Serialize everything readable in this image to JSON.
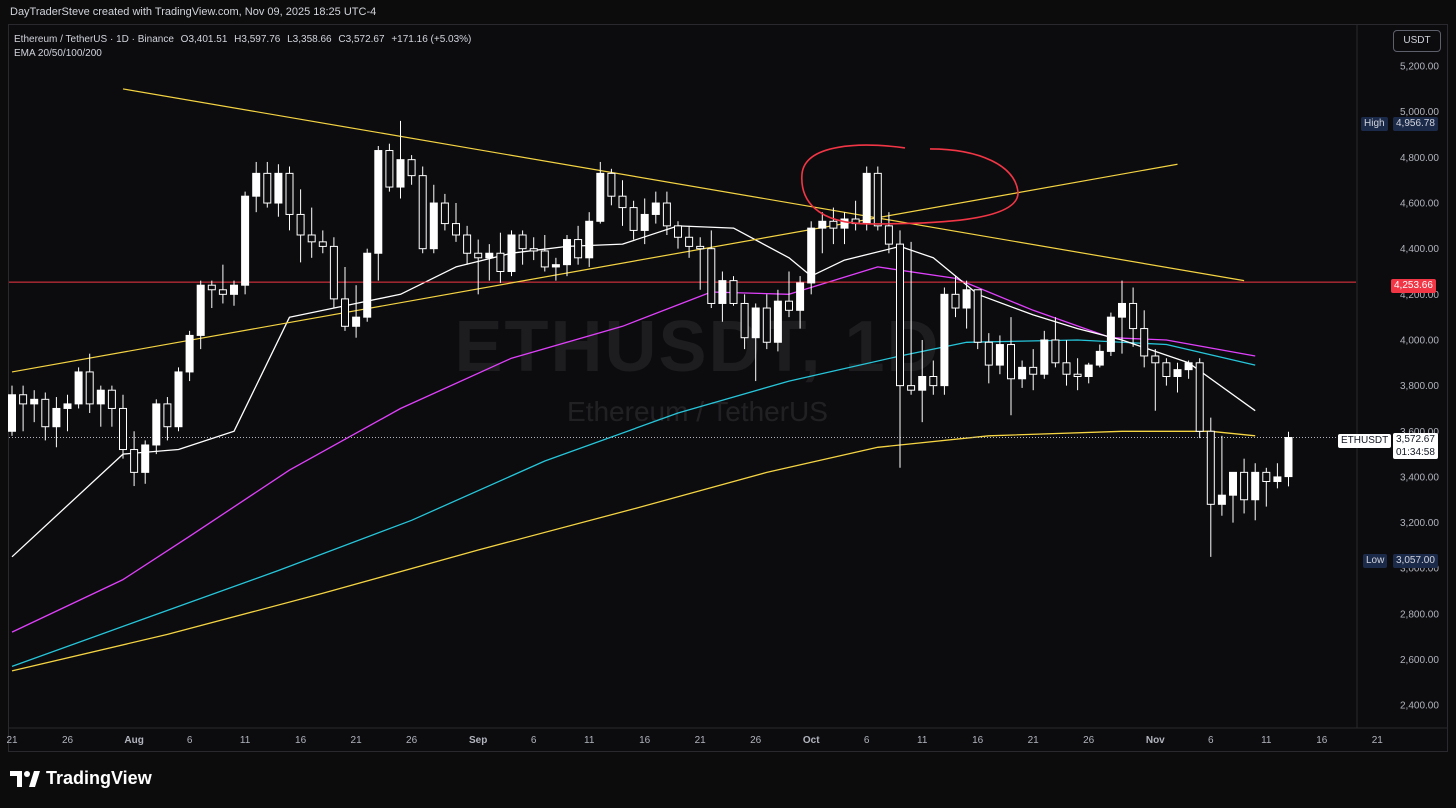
{
  "topbar": {
    "attribution": "DayTraderSteve created with TradingView.com, Nov 09, 2025 18:25 UTC-4"
  },
  "legend": {
    "symbol": "Ethereum / TetherUS · 1D · Binance",
    "open": "O3,401.51",
    "high": "H3,597.76",
    "low": "L3,358.66",
    "close": "C3,572.67",
    "change": "+171.16 (+5.03%)",
    "indicator": "EMA 20/50/100/200"
  },
  "watermark": {
    "ticker": "ETHUSDT, 1D",
    "name": "Ethereum / TetherUS"
  },
  "currency_button": "USDT",
  "tags": {
    "high_label": "High",
    "high_value": "4,956.78",
    "low_label": "Low",
    "low_value": "3,057.00",
    "hline_value": "4,253.66",
    "last_symbol": "ETHUSDT",
    "last_price": "3,572.67",
    "countdown": "01:34:58"
  },
  "logo_text": "TradingView",
  "colors": {
    "up": "#ffffff",
    "down": "#ffffff",
    "ema20": "#ffffff",
    "ema50": "#e040fb",
    "ema100": "#26c6da",
    "ema200": "#f5d442",
    "trendline": "#f5d442",
    "hline": "#f23645",
    "circle": "#f23645",
    "axis_text": "#b2b5be"
  },
  "chart_data": {
    "type": "candlestick",
    "ylim": [
      2300,
      5380
    ],
    "y_ticks": [
      "2,400.00",
      "2,600.00",
      "2,800.00",
      "3,000.00",
      "3,200.00",
      "3,400.00",
      "3,600.00",
      "3,800.00",
      "4,000.00",
      "4,200.00",
      "4,400.00",
      "4,600.00",
      "4,800.00",
      "5,000.00",
      "5,200.00"
    ],
    "y_tick_values": [
      2400,
      2600,
      2800,
      3000,
      3200,
      3400,
      3600,
      3800,
      4000,
      4200,
      4400,
      4600,
      4800,
      5000,
      5200
    ],
    "x_ticks": [
      {
        "label": "21",
        "i": 0
      },
      {
        "label": "26",
        "i": 5
      },
      {
        "label": "Aug",
        "i": 11
      },
      {
        "label": "6",
        "i": 16
      },
      {
        "label": "11",
        "i": 21
      },
      {
        "label": "16",
        "i": 26
      },
      {
        "label": "21",
        "i": 31
      },
      {
        "label": "26",
        "i": 36
      },
      {
        "label": "Sep",
        "i": 42
      },
      {
        "label": "6",
        "i": 47
      },
      {
        "label": "11",
        "i": 52
      },
      {
        "label": "16",
        "i": 57
      },
      {
        "label": "21",
        "i": 62
      },
      {
        "label": "26",
        "i": 67
      },
      {
        "label": "Oct",
        "i": 72
      },
      {
        "label": "6",
        "i": 77
      },
      {
        "label": "11",
        "i": 82
      },
      {
        "label": "16",
        "i": 87
      },
      {
        "label": "21",
        "i": 92
      },
      {
        "label": "26",
        "i": 97
      },
      {
        "label": "Nov",
        "i": 103
      },
      {
        "label": "6",
        "i": 108
      },
      {
        "label": "11",
        "i": 113
      },
      {
        "label": "16",
        "i": 118
      },
      {
        "label": "21",
        "i": 123
      }
    ],
    "candles": [
      [
        3600,
        3800,
        3580,
        3760
      ],
      [
        3760,
        3800,
        3600,
        3720
      ],
      [
        3720,
        3780,
        3640,
        3740
      ],
      [
        3740,
        3770,
        3560,
        3620
      ],
      [
        3620,
        3750,
        3530,
        3700
      ],
      [
        3700,
        3760,
        3600,
        3720
      ],
      [
        3720,
        3880,
        3700,
        3860
      ],
      [
        3860,
        3940,
        3680,
        3720
      ],
      [
        3720,
        3800,
        3620,
        3780
      ],
      [
        3780,
        3800,
        3620,
        3700
      ],
      [
        3700,
        3760,
        3480,
        3520
      ],
      [
        3520,
        3600,
        3360,
        3420
      ],
      [
        3420,
        3560,
        3370,
        3540
      ],
      [
        3540,
        3740,
        3500,
        3720
      ],
      [
        3720,
        3750,
        3560,
        3620
      ],
      [
        3620,
        3880,
        3600,
        3860
      ],
      [
        3860,
        4040,
        3820,
        4020
      ],
      [
        4020,
        4260,
        3960,
        4240
      ],
      [
        4240,
        4260,
        4140,
        4220
      ],
      [
        4220,
        4330,
        4160,
        4200
      ],
      [
        4200,
        4260,
        4150,
        4240
      ],
      [
        4240,
        4650,
        4200,
        4630
      ],
      [
        4630,
        4780,
        4560,
        4730
      ],
      [
        4730,
        4780,
        4580,
        4600
      ],
      [
        4600,
        4770,
        4540,
        4730
      ],
      [
        4730,
        4760,
        4480,
        4550
      ],
      [
        4550,
        4660,
        4340,
        4460
      ],
      [
        4460,
        4580,
        4360,
        4430
      ],
      [
        4430,
        4480,
        4380,
        4410
      ],
      [
        4410,
        4450,
        4140,
        4180
      ],
      [
        4180,
        4320,
        4040,
        4060
      ],
      [
        4060,
        4240,
        4010,
        4100
      ],
      [
        4100,
        4400,
        4080,
        4380
      ],
      [
        4380,
        4850,
        4260,
        4830
      ],
      [
        4830,
        4860,
        4650,
        4670
      ],
      [
        4670,
        4960,
        4620,
        4790
      ],
      [
        4790,
        4810,
        4680,
        4720
      ],
      [
        4720,
        4760,
        4380,
        4400
      ],
      [
        4400,
        4680,
        4380,
        4600
      ],
      [
        4600,
        4640,
        4480,
        4510
      ],
      [
        4510,
        4600,
        4430,
        4460
      ],
      [
        4460,
        4500,
        4330,
        4380
      ],
      [
        4380,
        4440,
        4200,
        4360
      ],
      [
        4360,
        4420,
        4260,
        4380
      ],
      [
        4380,
        4470,
        4250,
        4300
      ],
      [
        4300,
        4480,
        4280,
        4460
      ],
      [
        4460,
        4480,
        4330,
        4400
      ],
      [
        4400,
        4450,
        4350,
        4390
      ],
      [
        4390,
        4460,
        4300,
        4320
      ],
      [
        4320,
        4360,
        4260,
        4330
      ],
      [
        4330,
        4460,
        4280,
        4440
      ],
      [
        4440,
        4500,
        4330,
        4360
      ],
      [
        4360,
        4560,
        4320,
        4520
      ],
      [
        4520,
        4780,
        4510,
        4730
      ],
      [
        4730,
        4750,
        4590,
        4630
      ],
      [
        4630,
        4700,
        4500,
        4580
      ],
      [
        4580,
        4610,
        4440,
        4480
      ],
      [
        4480,
        4620,
        4420,
        4550
      ],
      [
        4550,
        4650,
        4510,
        4600
      ],
      [
        4600,
        4650,
        4460,
        4500
      ],
      [
        4500,
        4520,
        4400,
        4450
      ],
      [
        4450,
        4500,
        4360,
        4410
      ],
      [
        4410,
        4450,
        4220,
        4400
      ],
      [
        4400,
        4480,
        4140,
        4160
      ],
      [
        4160,
        4300,
        4080,
        4260
      ],
      [
        4260,
        4280,
        4150,
        4160
      ],
      [
        4160,
        4200,
        3960,
        4010
      ],
      [
        4010,
        4160,
        3820,
        4140
      ],
      [
        4140,
        4200,
        3960,
        3990
      ],
      [
        3990,
        4220,
        3950,
        4170
      ],
      [
        4170,
        4300,
        4100,
        4130
      ],
      [
        4130,
        4280,
        4050,
        4250
      ],
      [
        4250,
        4520,
        4200,
        4490
      ],
      [
        4490,
        4560,
        4380,
        4520
      ],
      [
        4520,
        4580,
        4420,
        4490
      ],
      [
        4490,
        4560,
        4420,
        4530
      ],
      [
        4530,
        4610,
        4480,
        4510
      ],
      [
        4510,
        4760,
        4480,
        4730
      ],
      [
        4730,
        4760,
        4480,
        4500
      ],
      [
        4500,
        4560,
        4380,
        4420
      ],
      [
        4420,
        4480,
        3440,
        3800
      ],
      [
        3800,
        4430,
        3760,
        3780
      ],
      [
        3780,
        4000,
        3640,
        3840
      ],
      [
        3840,
        3910,
        3760,
        3800
      ],
      [
        3800,
        4230,
        3760,
        4200
      ],
      [
        4200,
        4280,
        4100,
        4140
      ],
      [
        4140,
        4260,
        4050,
        4220
      ],
      [
        4220,
        4220,
        3960,
        3990
      ],
      [
        3990,
        4030,
        3810,
        3890
      ],
      [
        3890,
        4020,
        3850,
        3980
      ],
      [
        3980,
        4100,
        3670,
        3830
      ],
      [
        3830,
        3910,
        3790,
        3880
      ],
      [
        3880,
        3960,
        3780,
        3850
      ],
      [
        3850,
        4040,
        3830,
        4000
      ],
      [
        4000,
        4100,
        3880,
        3900
      ],
      [
        3900,
        4000,
        3800,
        3850
      ],
      [
        3850,
        3920,
        3780,
        3840
      ],
      [
        3840,
        3900,
        3810,
        3890
      ],
      [
        3890,
        3980,
        3880,
        3950
      ],
      [
        3950,
        4120,
        3930,
        4100
      ],
      [
        4100,
        4260,
        3940,
        4160
      ],
      [
        4160,
        4230,
        3970,
        4050
      ],
      [
        4050,
        4130,
        3880,
        3930
      ],
      [
        3930,
        3960,
        3690,
        3900
      ],
      [
        3900,
        3920,
        3800,
        3840
      ],
      [
        3840,
        3900,
        3770,
        3870
      ],
      [
        3870,
        3910,
        3830,
        3900
      ],
      [
        3900,
        3920,
        3570,
        3600
      ],
      [
        3600,
        3660,
        3050,
        3280
      ],
      [
        3280,
        3580,
        3230,
        3320
      ],
      [
        3320,
        3400,
        3200,
        3420
      ],
      [
        3420,
        3480,
        3240,
        3300
      ],
      [
        3300,
        3460,
        3210,
        3420
      ],
      [
        3420,
        3440,
        3270,
        3380
      ],
      [
        3380,
        3460,
        3350,
        3400
      ],
      [
        3401.51,
        3597.76,
        3358.66,
        3572.67
      ]
    ],
    "ema20": [
      [
        0,
        3050
      ],
      [
        10,
        3500
      ],
      [
        15,
        3520
      ],
      [
        20,
        3600
      ],
      [
        25,
        4100
      ],
      [
        30,
        4150
      ],
      [
        35,
        4200
      ],
      [
        40,
        4320
      ],
      [
        45,
        4380
      ],
      [
        50,
        4410
      ],
      [
        55,
        4420
      ],
      [
        60,
        4500
      ],
      [
        65,
        4490
      ],
      [
        70,
        4360
      ],
      [
        72,
        4280
      ],
      [
        75,
        4350
      ],
      [
        80,
        4410
      ],
      [
        83,
        4360
      ],
      [
        87,
        4200
      ],
      [
        92,
        4110
      ],
      [
        96,
        4050
      ],
      [
        100,
        4000
      ],
      [
        106,
        3900
      ],
      [
        112,
        3690
      ]
    ],
    "ema50": [
      [
        0,
        2720
      ],
      [
        10,
        2950
      ],
      [
        16,
        3140
      ],
      [
        25,
        3430
      ],
      [
        35,
        3700
      ],
      [
        45,
        3920
      ],
      [
        55,
        4060
      ],
      [
        63,
        4210
      ],
      [
        70,
        4200
      ],
      [
        78,
        4320
      ],
      [
        85,
        4270
      ],
      [
        92,
        4130
      ],
      [
        99,
        4010
      ],
      [
        104,
        4000
      ],
      [
        112,
        3930
      ]
    ],
    "ema100": [
      [
        0,
        2570
      ],
      [
        12,
        2780
      ],
      [
        24,
        2990
      ],
      [
        36,
        3210
      ],
      [
        48,
        3470
      ],
      [
        60,
        3680
      ],
      [
        70,
        3820
      ],
      [
        80,
        3930
      ],
      [
        86,
        3990
      ],
      [
        96,
        4000
      ],
      [
        104,
        3980
      ],
      [
        112,
        3890
      ]
    ],
    "ema200": [
      [
        0,
        2550
      ],
      [
        14,
        2710
      ],
      [
        28,
        2890
      ],
      [
        42,
        3080
      ],
      [
        56,
        3260
      ],
      [
        68,
        3420
      ],
      [
        78,
        3530
      ],
      [
        88,
        3580
      ],
      [
        100,
        3600
      ],
      [
        108,
        3600
      ],
      [
        112,
        3580
      ]
    ],
    "trendlines": [
      {
        "from": [
          10,
          5100
        ],
        "to": [
          111,
          4260
        ]
      },
      {
        "from": [
          0,
          3860
        ],
        "to": [
          105,
          4770
        ]
      }
    ],
    "hline": 4253.66,
    "last_price": 3572.67,
    "high": 4956.78,
    "low": 3057.0,
    "circle": {
      "i": 80,
      "price": 4640
    }
  }
}
